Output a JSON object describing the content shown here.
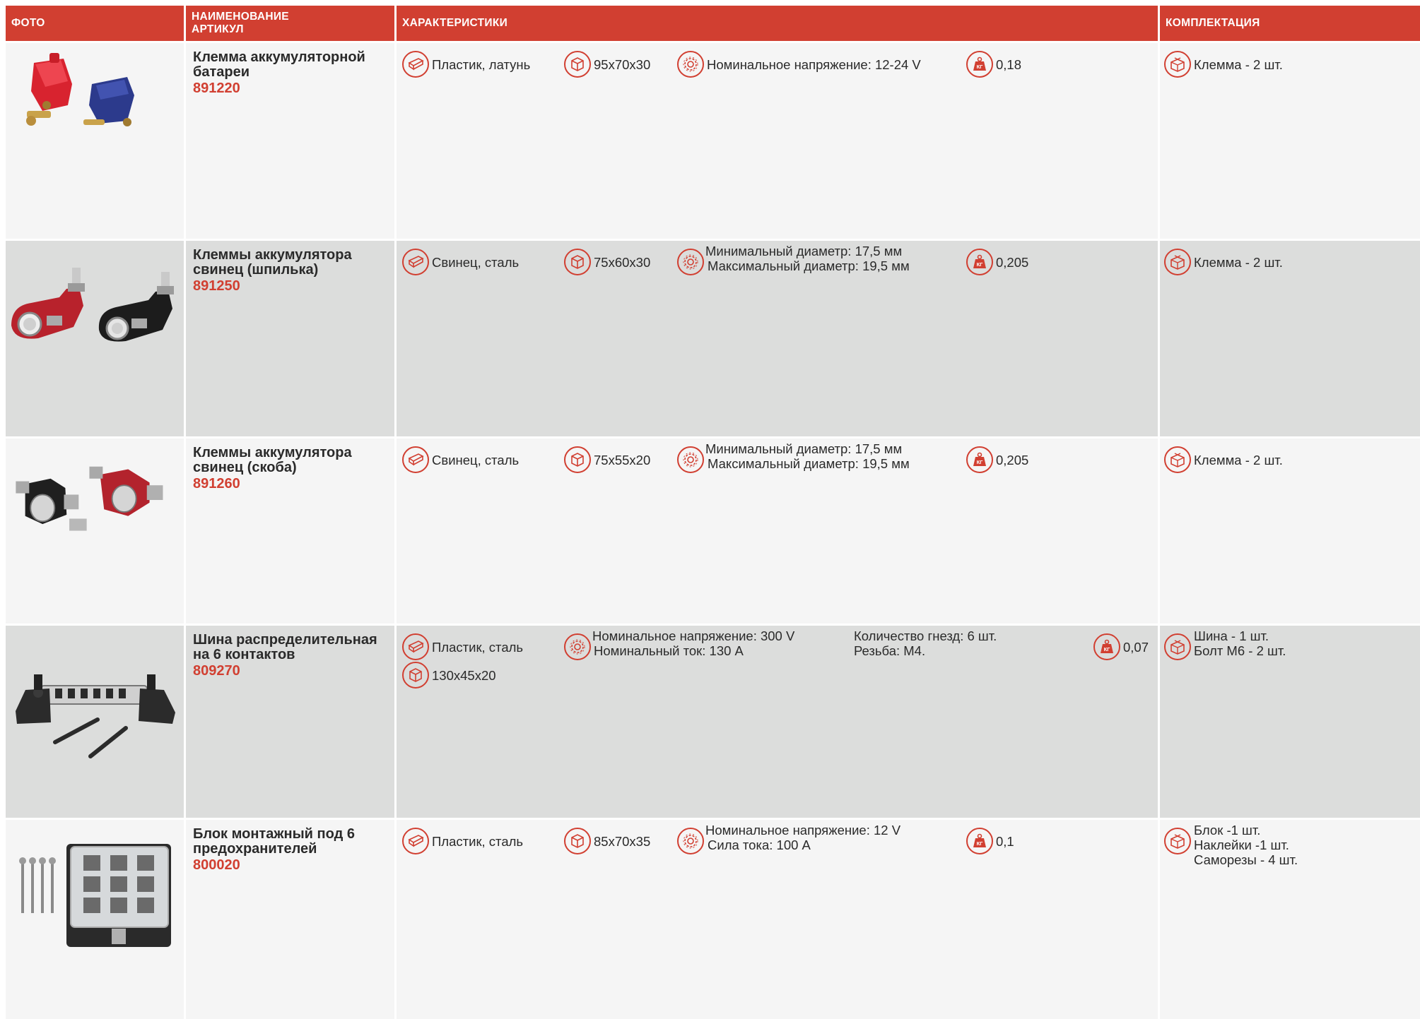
{
  "header": {
    "photo": "ФОТО",
    "name_line1": "НАИМЕНОВАНИЕ",
    "name_line2": "АРТИКУЛ",
    "specs": "ХАРАКТЕРИСТИКИ",
    "kit": "КОМПЛЕКТАЦИЯ"
  },
  "colors": {
    "accent": "#d13f31",
    "row_light": "#f5f5f5",
    "row_dark": "#dcdddc"
  },
  "icons": {
    "material": "material-icon",
    "size": "box-size-icon",
    "params": "gear-icon",
    "weight": "weight-kg-icon",
    "kit": "package-icon"
  },
  "products": [
    {
      "name": "Клемма аккумуляторной батареи",
      "code": "891220",
      "material": "Пластик, латунь",
      "size": "95x70x30",
      "params": [
        "Номинальное напряжение: 12-24 V"
      ],
      "weight": "0,18",
      "kit": [
        "Клемма - 2 шт."
      ]
    },
    {
      "name": "Клеммы аккумулятора свинец (шпилька)",
      "code": "891250",
      "material": "Свинец, сталь",
      "size": "75x60x30",
      "params": [
        "Минимальный диаметр: 17,5 мм",
        "Максимальный диаметр: 19,5 мм"
      ],
      "weight": "0,205",
      "kit": [
        "Клемма - 2 шт."
      ]
    },
    {
      "name": "Клеммы аккумулятора свинец (скоба)",
      "code": "891260",
      "material": "Свинец, сталь",
      "size": "75x55x20",
      "params": [
        "Минимальный диаметр: 17,5 мм",
        "Максимальный диаметр: 19,5 мм"
      ],
      "weight": "0,205",
      "kit": [
        "Клемма - 2 шт."
      ]
    },
    {
      "name": "Шина распределительная на 6 контактов",
      "code": "809270",
      "material": "Пластик, сталь",
      "size": "130x45x20",
      "params": [
        "Номинальное напряжение: 300 V",
        "Номинальный ток: 130 А"
      ],
      "params_extra": [
        "Количество гнезд: 6 шт.",
        "Резьба: М4."
      ],
      "weight": "0,07",
      "kit": [
        "Шина - 1 шт.",
        "Болт М6 - 2 шт."
      ]
    },
    {
      "name": "Блок монтажный под 6 предохранителей",
      "code": "800020",
      "material": "Пластик, сталь",
      "size": "85x70x35",
      "params": [
        "Номинальное напряжение: 12 V",
        "Сила тока: 100 А"
      ],
      "weight": "0,1",
      "kit": [
        "Блок -1 шт.",
        "Наклейки -1 шт.",
        "Саморезы - 4 шт."
      ]
    }
  ]
}
